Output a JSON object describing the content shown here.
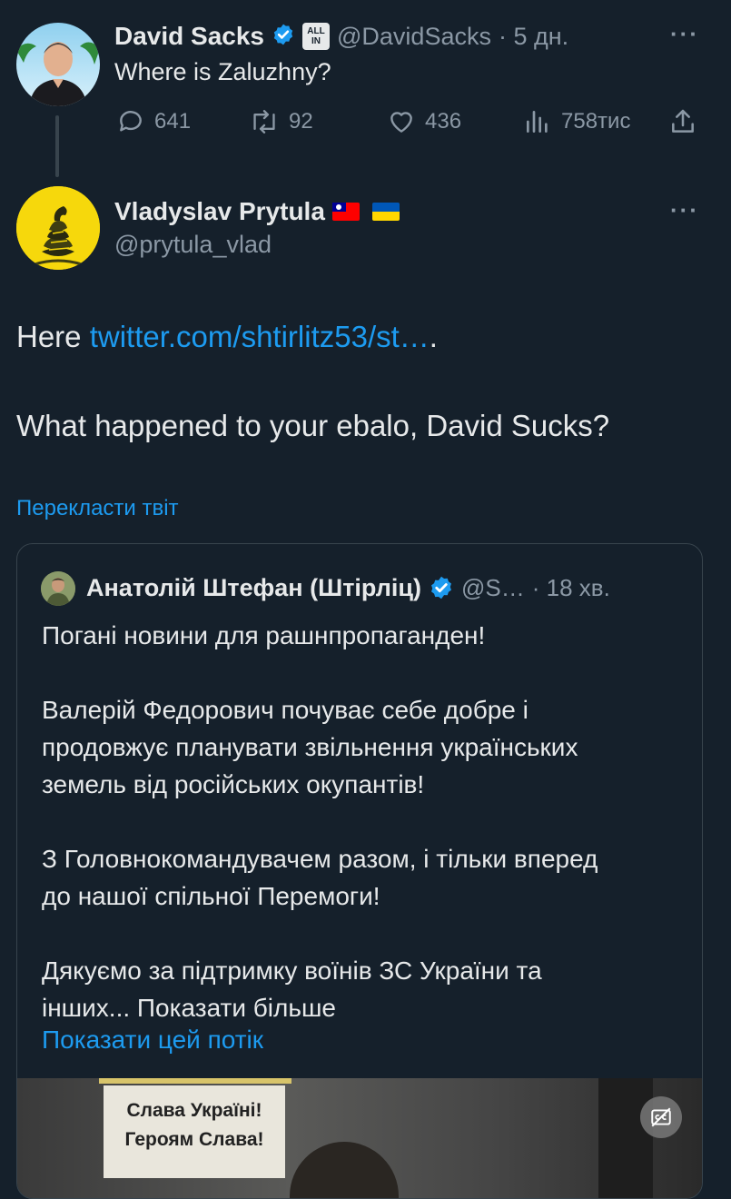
{
  "tweet1": {
    "name": "David Sacks",
    "allin_badge": "ALL IN",
    "handle": "@DavidSacks",
    "time": "· 5 дн.",
    "text": "Where is Zaluzhny?",
    "stats": {
      "replies": "641",
      "retweets": "92",
      "likes": "436",
      "views": "758тис"
    }
  },
  "tweet2": {
    "name": "Vladyslav Prytula",
    "flags": "🇹🇼 🇺🇦",
    "handle": "@prytula_vlad",
    "text_prefix": "Here ",
    "link": "twitter.com/shtirlitz53/st…",
    "text_suffix": ".",
    "text2": "What happened to your ebalo, David Sucks?",
    "translate": "Перекласти твіт"
  },
  "quote": {
    "name": "Анатолій Штефан (Штірліц)",
    "handle": "@S…",
    "time": "· 18 хв.",
    "p1": "Погані новини для рашнпропаганден!",
    "p2_line1": "Валерій Федорович почуває себе добре і",
    "p2_line2": "продовжує планувати звільнення українських",
    "p2_line3": "земель від російських окупантів!",
    "p3_line1": "З Головнокомандувачем разом, і тільки вперед",
    "p3_line2": "до нашої спільної Перемоги!",
    "p4_line1": "Дякуємо за підтримку воїнів ЗС України та",
    "p4_line2": "інших... Показати більше",
    "show_thread": "Показати цей потік",
    "image_sign_line1": "Слава Україні!",
    "image_sign_line2": "Героям Слава!"
  },
  "colors": {
    "background": "#15202b",
    "link": "#1d9bf0",
    "muted": "#8b98a5",
    "text": "#e7e9ea"
  }
}
